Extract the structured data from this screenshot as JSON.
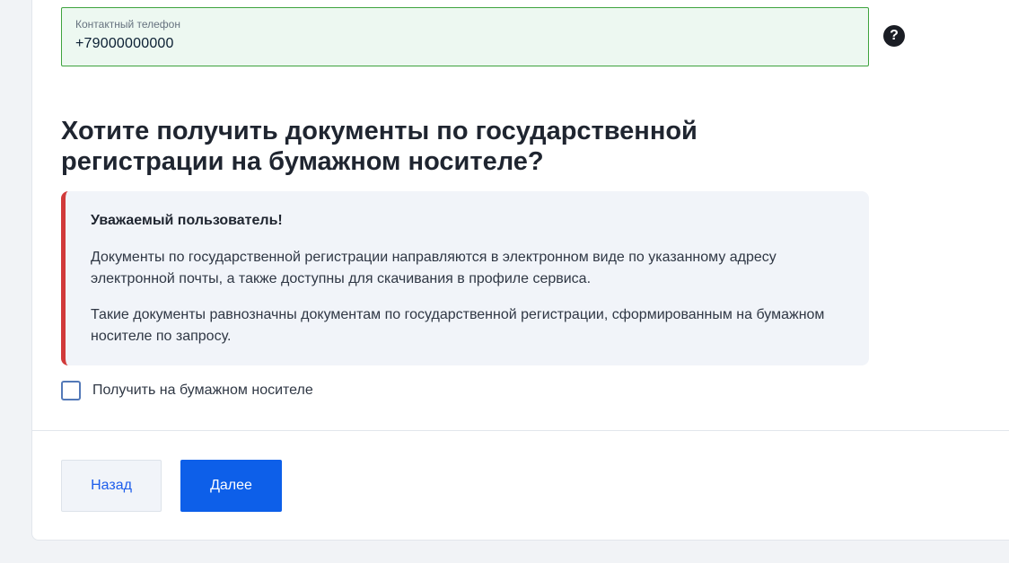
{
  "phone": {
    "label": "Контактный телефон",
    "value": "+79000000000"
  },
  "help_icon": {
    "glyph": "?",
    "icon": "question-circle-icon"
  },
  "question": {
    "line1": "Хотите получить документы по государственной",
    "line2": "регистрации на бумажном носителе?"
  },
  "notice": {
    "title": "Уважаемый пользователь!",
    "paragraph1": "Документы по государственной регистрации направляются в электронном виде по указанному адресу электронной почты, а также доступны для скачивания в профиле сервиса.",
    "paragraph2": "Такие документы равнозначны документам по государственной регистрации, сформированным на бумажном носителе по запросу.",
    "accent_color": "#d13a3a"
  },
  "paper_checkbox": {
    "label": "Получить на бумажном носителе",
    "checked": false
  },
  "buttons": {
    "back_label": "Назад",
    "next_label": "Далее"
  },
  "colors": {
    "primary": "#0d5fe9",
    "valid_border": "#3ea33e",
    "valid_bg": "#edf8f1"
  }
}
